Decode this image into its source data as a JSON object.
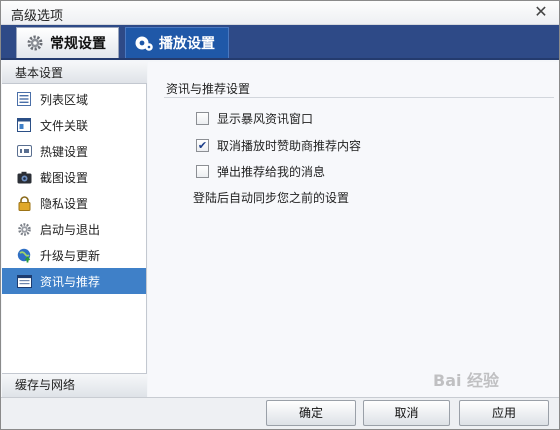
{
  "window": {
    "title": "高级选项"
  },
  "tabs": [
    {
      "label": "常规设置",
      "icon": "gear-icon"
    },
    {
      "label": "播放设置",
      "icon": "play-settings-icon"
    }
  ],
  "sidebar": {
    "header": "基本设置",
    "items": [
      {
        "label": "列表区域",
        "icon": "list-icon"
      },
      {
        "label": "文件关联",
        "icon": "file-association-icon"
      },
      {
        "label": "热键设置",
        "icon": "hotkey-icon"
      },
      {
        "label": "截图设置",
        "icon": "camera-icon"
      },
      {
        "label": "隐私设置",
        "icon": "lock-icon"
      },
      {
        "label": "启动与退出",
        "icon": "startup-gear-icon"
      },
      {
        "label": "升级与更新",
        "icon": "upgrade-globe-icon"
      },
      {
        "label": "资讯与推荐",
        "icon": "news-icon"
      }
    ],
    "active_index": 7,
    "footer": "缓存与网络"
  },
  "content": {
    "section_title": "资讯与推荐设置",
    "options": [
      {
        "label": "显示暴风资讯窗口",
        "checked": false
      },
      {
        "label": "取消播放时赞助商推荐内容",
        "checked": true
      },
      {
        "label": "弹出推荐给我的消息",
        "checked": false
      }
    ],
    "note": "登陆后自动同步您之前的设置"
  },
  "buttons": {
    "ok": "确定",
    "cancel": "取消",
    "apply": "应用"
  },
  "watermark": "Bai 经验",
  "colors": {
    "tabbar": "#2e4a87",
    "active_tab": "#1f58a8",
    "selected_item": "#3f80c8"
  }
}
